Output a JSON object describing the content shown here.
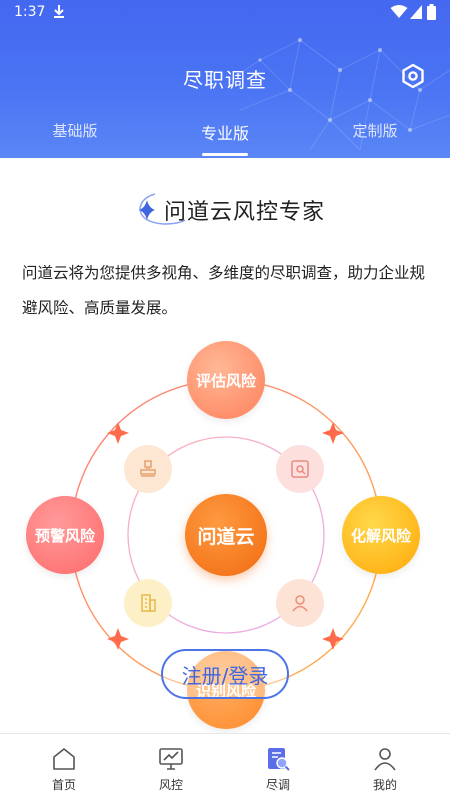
{
  "status_bar": {
    "time": "1:37"
  },
  "header": {
    "title": "尽职调查"
  },
  "tabs": [
    {
      "label": "基础版",
      "active": false
    },
    {
      "label": "专业版",
      "active": true
    },
    {
      "label": "定制版",
      "active": false
    }
  ],
  "brand": {
    "title": "问道云风控专家"
  },
  "intro": "问道云将为您提供多视角、多维度的尽职调查，助力企业规避风险、高质量发展。",
  "diagram": {
    "center": "问道云",
    "nodes": {
      "top": "评估风险",
      "right": "化解风险",
      "bottom": "识别风险",
      "left": "预警风险"
    },
    "small_icons": [
      "stamp-icon",
      "document-search-icon",
      "building-icon",
      "person-icon"
    ]
  },
  "register_button": "注册/登录",
  "bottom_nav": [
    {
      "label": "首页",
      "icon": "home-icon",
      "active": false
    },
    {
      "label": "风控",
      "icon": "risk-monitor-icon",
      "active": false
    },
    {
      "label": "尽调",
      "icon": "due-diligence-icon",
      "active": true
    },
    {
      "label": "我的",
      "icon": "user-icon",
      "active": false
    }
  ],
  "colors": {
    "header_blue": "#4a74f3",
    "accent_blue": "#3f66e0",
    "orange": "#f06a10",
    "nav_active": "#5b6ee8"
  }
}
